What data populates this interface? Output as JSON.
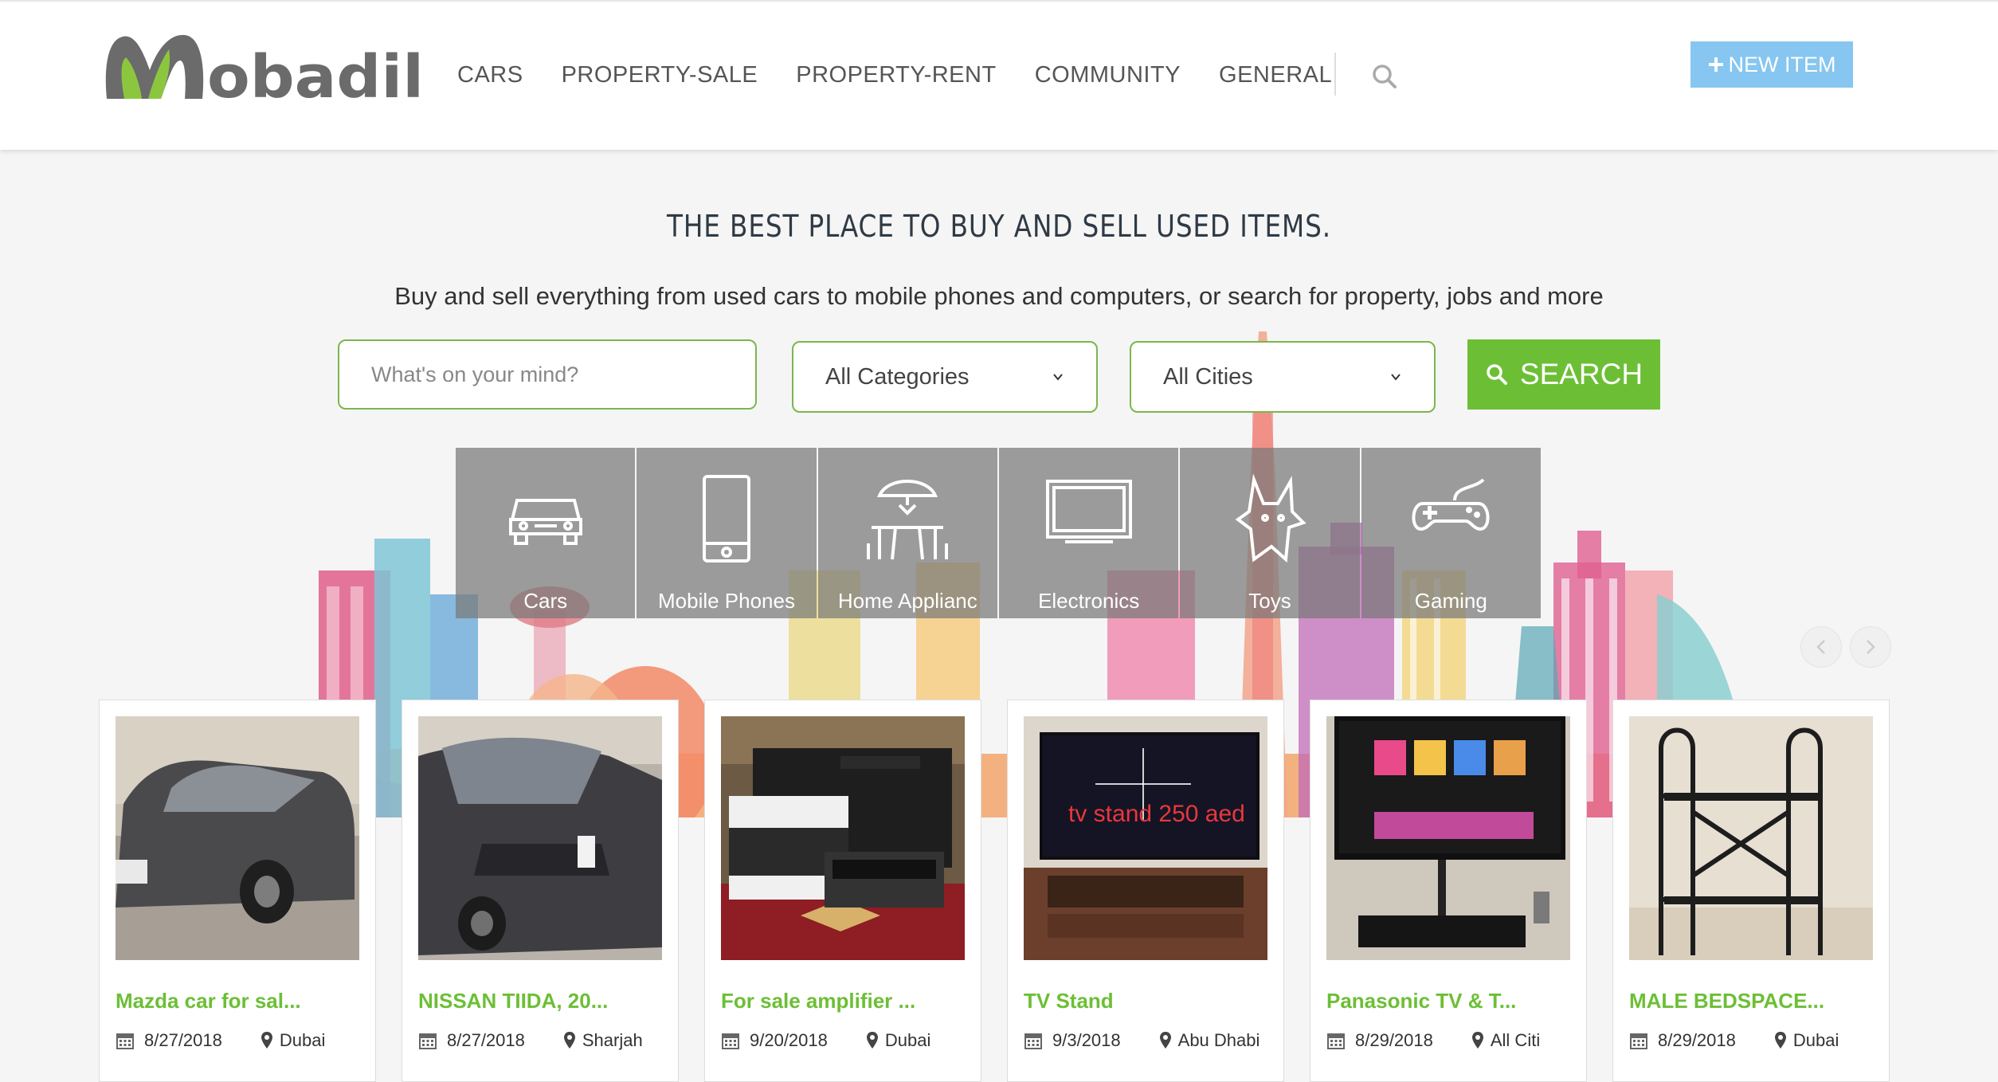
{
  "header": {
    "logo_text": "Mobadil",
    "nav": [
      "CARS",
      "PROPERTY-SALE",
      "PROPERTY-RENT",
      "COMMUNITY",
      "GENERAL"
    ],
    "new_item_label": "NEW ITEM"
  },
  "hero": {
    "title": "THE BEST PLACE TO BUY AND SELL USED ITEMS.",
    "subtitle": "Buy and sell everything from used cars to mobile phones and computers, or search for property, jobs and more",
    "search_placeholder": "What's on your mind?",
    "category_select": "All Categories",
    "city_select": "All Cities",
    "search_button": "SEARCH"
  },
  "categories": [
    {
      "label": "Cars",
      "icon": "car-icon"
    },
    {
      "label": "Mobile Phones",
      "icon": "mobile-phone-icon"
    },
    {
      "label": "Home Applianc",
      "icon": "home-appliance-icon"
    },
    {
      "label": "Electronics",
      "icon": "monitor-icon"
    },
    {
      "label": "Toys",
      "icon": "toy-icon"
    },
    {
      "label": "Gaming",
      "icon": "gamepad-icon"
    }
  ],
  "listings": [
    {
      "title": "Mazda car for sal...",
      "date": "8/27/2018",
      "location": "Dubai"
    },
    {
      "title": "NISSAN TIIDA, 20...",
      "date": "8/27/2018",
      "location": "Sharjah"
    },
    {
      "title": "For sale amplifier ...",
      "date": "9/20/2018",
      "location": "Dubai"
    },
    {
      "title": "TV Stand",
      "date": "9/3/2018",
      "location": "Abu Dhabi",
      "photo_caption": "tv stand 250 aed"
    },
    {
      "title": "Panasonic TV & T...",
      "date": "8/29/2018",
      "location": "All Citi"
    },
    {
      "title": "MALE BEDSPACE...",
      "date": "8/29/2018",
      "location": "Dubai"
    }
  ],
  "colors": {
    "brand_green": "#6cbf35",
    "new_item_blue": "#86c6f0",
    "logo_gray": "#6b6b6b",
    "logo_green": "#8cc63f"
  }
}
